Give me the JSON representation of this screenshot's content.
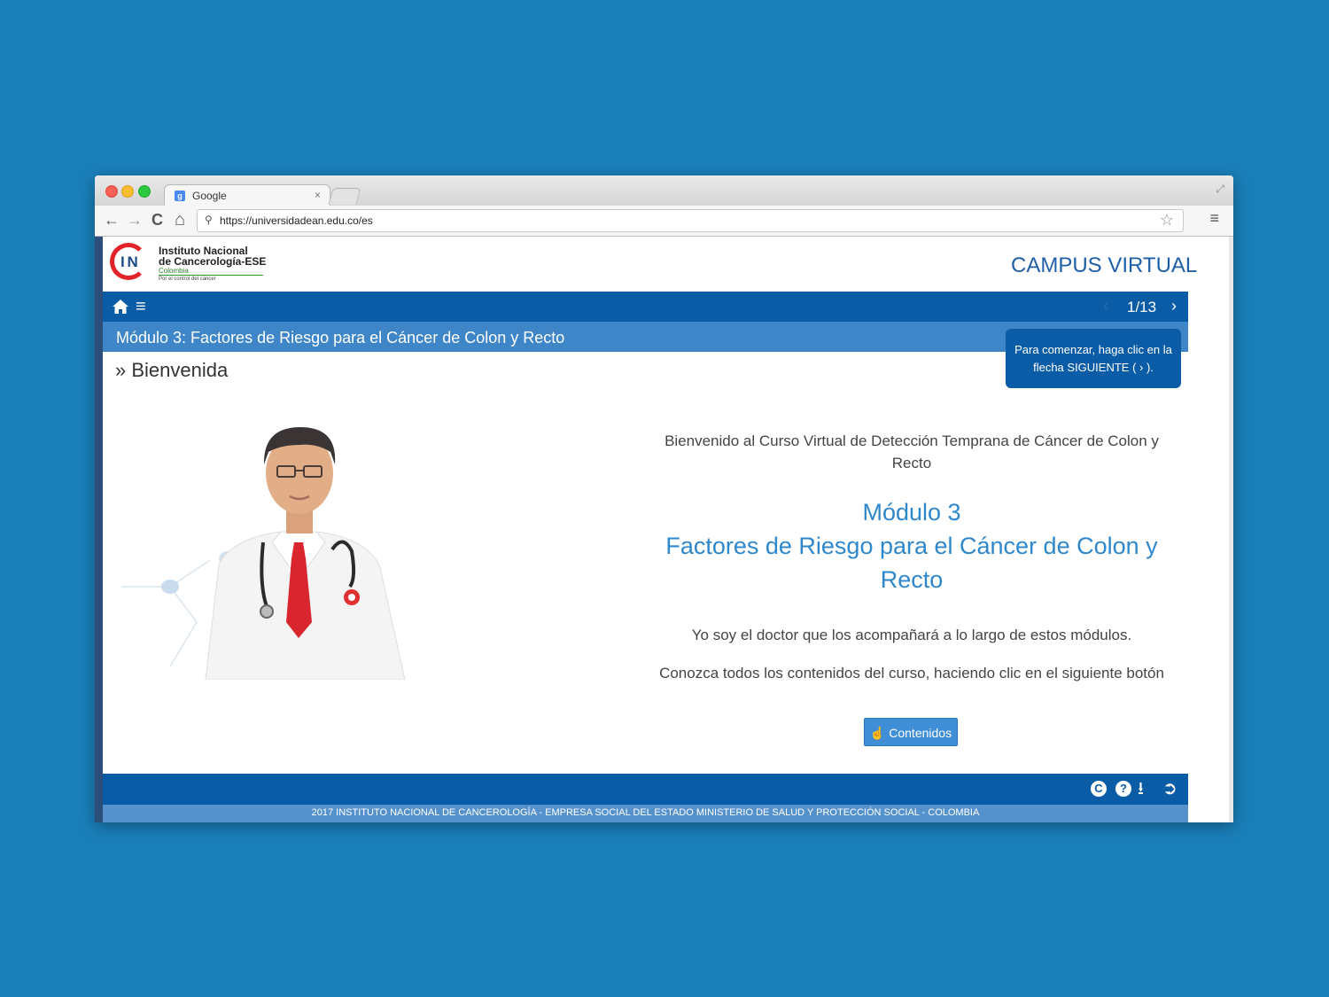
{
  "browser": {
    "tab_title": "Google",
    "tab_close": "×",
    "url": "https://universidadean.edu.co/es",
    "back": "←",
    "forward": "→",
    "reload": "C",
    "home": "⌂",
    "star": "☆",
    "menu": "≡",
    "search_glyph": "⚲",
    "fullscreen": "⤢"
  },
  "logo": {
    "mark": "I N",
    "line1": "Instituto Nacional",
    "line2": "de Cancerología-ESE",
    "line3": "Colombia",
    "line4": "Por el control del cáncer"
  },
  "header": {
    "campus_label": "CAMPUS VIRTUAL"
  },
  "navbar": {
    "prev": "‹",
    "page_counter": "1/13",
    "next": "›",
    "menu_glyph": "≡"
  },
  "module_bar": {
    "title": "Módulo 3: Factores de Riesgo para el Cáncer de Colon y Recto"
  },
  "tooltip": {
    "text": "Para comenzar, haga clic en la flecha SIGUIENTE ( › )."
  },
  "breadcrumb": "» Bienvenida",
  "content": {
    "welcome": "Bienvenido al Curso Virtual de Detección Temprana de Cáncer de Colon y Recto",
    "module_number": "Módulo 3",
    "module_name": "Factores de Riesgo para el Cáncer de Colon y Recto",
    "intro1": "Yo soy el doctor que los acompañará a lo largo de estos módulos.",
    "intro2": "Conozca todos los contenidos del curso, haciendo clic en el siguiente botón",
    "contents_button": "☝ Contenidos"
  },
  "footer": {
    "icons": [
      "C",
      "?",
      "⭳",
      "➲"
    ],
    "copyright": "2017 INSTITUTO NACIONAL DE CANCEROLOGÍA - EMPRESA SOCIAL DEL ESTADO MINISTERIO DE SALUD Y PROTECCIÓN SOCIAL - COLOMBIA"
  },
  "colors": {
    "background": "#1a7fb9",
    "nav_blue": "#0b5ca7",
    "module_blue": "#3e86c7",
    "heading_blue": "#2f87cc",
    "logo_red": "#e2232a"
  }
}
